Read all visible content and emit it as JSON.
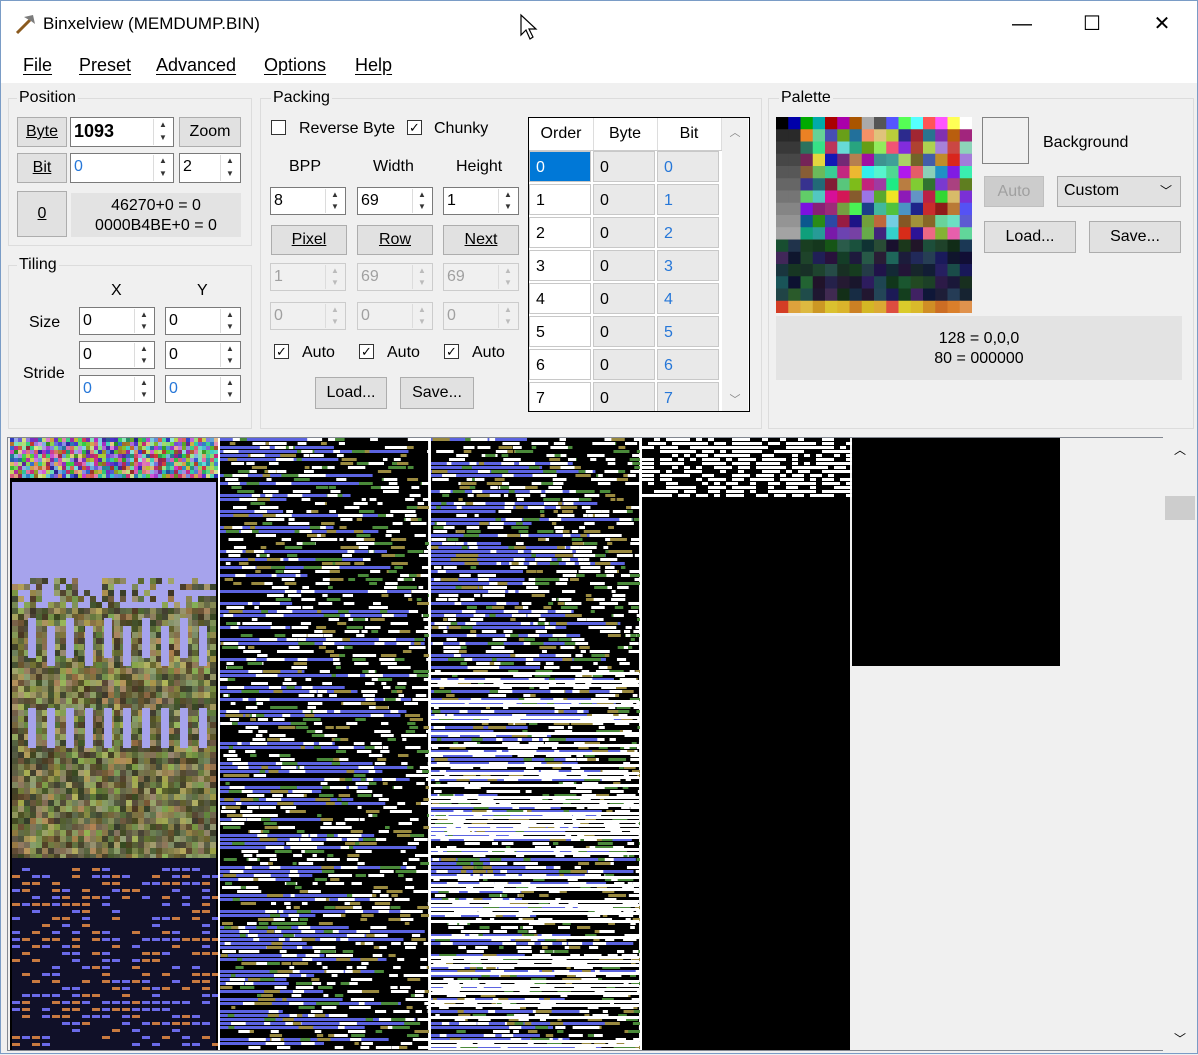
{
  "window": {
    "title": "Binxelview (MEMDUMP.BIN)",
    "minimize": "—",
    "maximize": "☐",
    "close": "✕"
  },
  "menu": [
    "File",
    "Preset",
    "Advanced",
    "Options",
    "Help"
  ],
  "position": {
    "label": "Position",
    "byte_button": "Byte",
    "byte_value": "1093",
    "zoom_button": "Zoom",
    "bit_button": "Bit",
    "bit_value": "0",
    "zoom_value": "2",
    "zero_button": "0",
    "info_line1": "46270+0 = 0",
    "info_line2": "0000B4BE+0 = 0"
  },
  "tiling": {
    "label": "Tiling",
    "x_header": "X",
    "y_header": "Y",
    "size_label": "Size",
    "stride_label": "Stride",
    "size_x": "0",
    "size_y": "0",
    "stride1_x": "0",
    "stride1_y": "0",
    "stride2_x": "0",
    "stride2_y": "0"
  },
  "packing": {
    "label": "Packing",
    "reverse_byte": "Reverse Byte",
    "reverse_checked": false,
    "chunky": "Chunky",
    "chunky_checked": true,
    "bpp_label": "BPP",
    "width_label": "Width",
    "height_label": "Height",
    "bpp": "8",
    "width": "69",
    "height": "1",
    "pixel_button": "Pixel",
    "row_button": "Row",
    "next_button": "Next",
    "pixel_val": "1",
    "row_val": "69",
    "next_val": "69",
    "pixel_val2": "0",
    "row_val2": "0",
    "next_val2": "0",
    "auto": "Auto",
    "load": "Load...",
    "save": "Save..."
  },
  "bit_table": {
    "headers": [
      "Order",
      "Byte",
      "Bit"
    ],
    "rows": [
      [
        "0",
        "0",
        "0"
      ],
      [
        "1",
        "0",
        "1"
      ],
      [
        "2",
        "0",
        "2"
      ],
      [
        "3",
        "0",
        "3"
      ],
      [
        "4",
        "0",
        "4"
      ],
      [
        "5",
        "0",
        "5"
      ],
      [
        "6",
        "0",
        "6"
      ],
      [
        "7",
        "0",
        "7"
      ]
    ]
  },
  "palette": {
    "label": "Palette",
    "background": "Background",
    "auto": "Auto",
    "mode": "Custom",
    "load": "Load...",
    "save": "Save...",
    "info_line1": "128 = 0,0,0",
    "info_line2": "80 = 000000"
  }
}
